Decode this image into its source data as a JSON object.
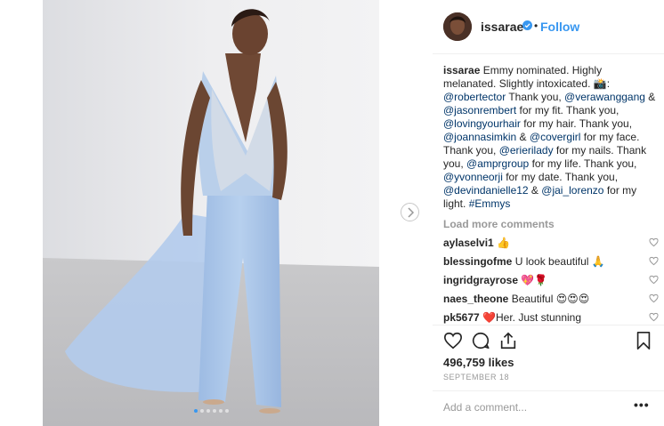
{
  "header": {
    "username": "issarae",
    "separator": "•",
    "follow_label": "Follow"
  },
  "caption": {
    "username": "issarae",
    "segments": [
      {
        "text": "Emmy nominated. Highly melanated. Slightly intoxicated. 📸: ",
        "link": false
      },
      {
        "text": "@robertector",
        "link": true
      },
      {
        "text": " Thank you, ",
        "link": false
      },
      {
        "text": "@verawanggang",
        "link": true
      },
      {
        "text": " & ",
        "link": false
      },
      {
        "text": "@jasonrembert",
        "link": true
      },
      {
        "text": " for my fit. Thank you, ",
        "link": false
      },
      {
        "text": "@lovingyourhair",
        "link": true
      },
      {
        "text": " for my hair. Thank you, ",
        "link": false
      },
      {
        "text": "@joannasimkin",
        "link": true
      },
      {
        "text": " & ",
        "link": false
      },
      {
        "text": "@covergirl",
        "link": true
      },
      {
        "text": " for my face. Thank you, ",
        "link": false
      },
      {
        "text": "@erierilady",
        "link": true
      },
      {
        "text": " for my nails. Thank you, ",
        "link": false
      },
      {
        "text": "@amprgroup",
        "link": true
      },
      {
        "text": " for my life. Thank you, ",
        "link": false
      },
      {
        "text": "@yvonneorji",
        "link": true
      },
      {
        "text": " for my date. Thank you, ",
        "link": false
      },
      {
        "text": "@devindanielle12",
        "link": true
      },
      {
        "text": " & ",
        "link": false
      },
      {
        "text": "@jai_lorenzo",
        "link": true
      },
      {
        "text": " for my light. ",
        "link": false
      },
      {
        "text": "#Emmys",
        "link": true
      }
    ]
  },
  "load_more_label": "Load more comments",
  "comments": [
    {
      "username": "aylaselvi1",
      "text": "👍"
    },
    {
      "username": "blessingofme",
      "text": "U look beautiful 🙏"
    },
    {
      "username": "ingridgrayrose",
      "text": "💖🌹"
    },
    {
      "username": "naes_theone",
      "text": "Beautiful 😍😍😍"
    },
    {
      "username": "pk5677",
      "text": "❤️Her. Just stunning"
    }
  ],
  "likes": "496,759 likes",
  "date": "SEPTEMBER 18",
  "add_comment_placeholder": "Add a comment...",
  "more_options": "•••",
  "carousel": {
    "count": 6,
    "active": 0
  },
  "colors": {
    "link": "#003569",
    "follow": "#3897f0",
    "muted": "#999999",
    "dress": "#a9c6ea"
  }
}
